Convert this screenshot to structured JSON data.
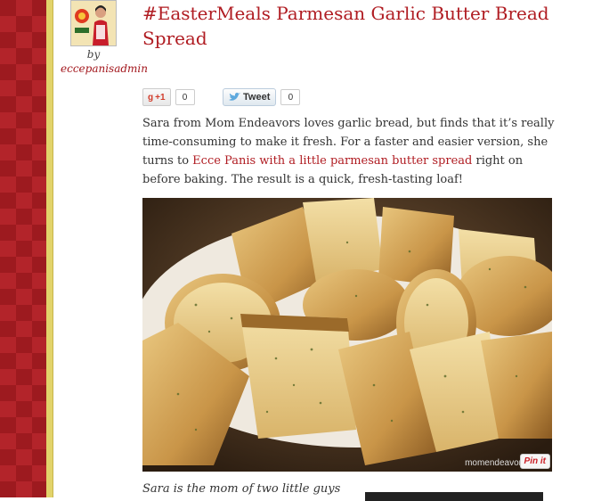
{
  "post": {
    "title": "#EasterMeals Parmesan Garlic Butter Bread Spread",
    "by_label": "by",
    "author": "eccepanisadmin"
  },
  "social": {
    "gplus_label": "+1",
    "gplus_count": "0",
    "tweet_label": "Tweet",
    "tweet_count": "0"
  },
  "body": {
    "text_before": "Sara from Mom Endeavors loves garlic bread, but finds that it’s really time-consuming to make it fresh. For a faster and easier version, she turns to ",
    "link_text": "Ecce Panis with a little parmesan butter spread",
    "text_after": " right on before baking. The result is a quick, fresh-tasting loaf!"
  },
  "photo": {
    "watermark": "momendeavor",
    "pin_label": "Pin it"
  },
  "caption": "Sara is the mom of two little guys",
  "colors": {
    "accent": "#b01c22",
    "side_red": "#9d1a1f",
    "side_gold": "#e2d36a"
  }
}
